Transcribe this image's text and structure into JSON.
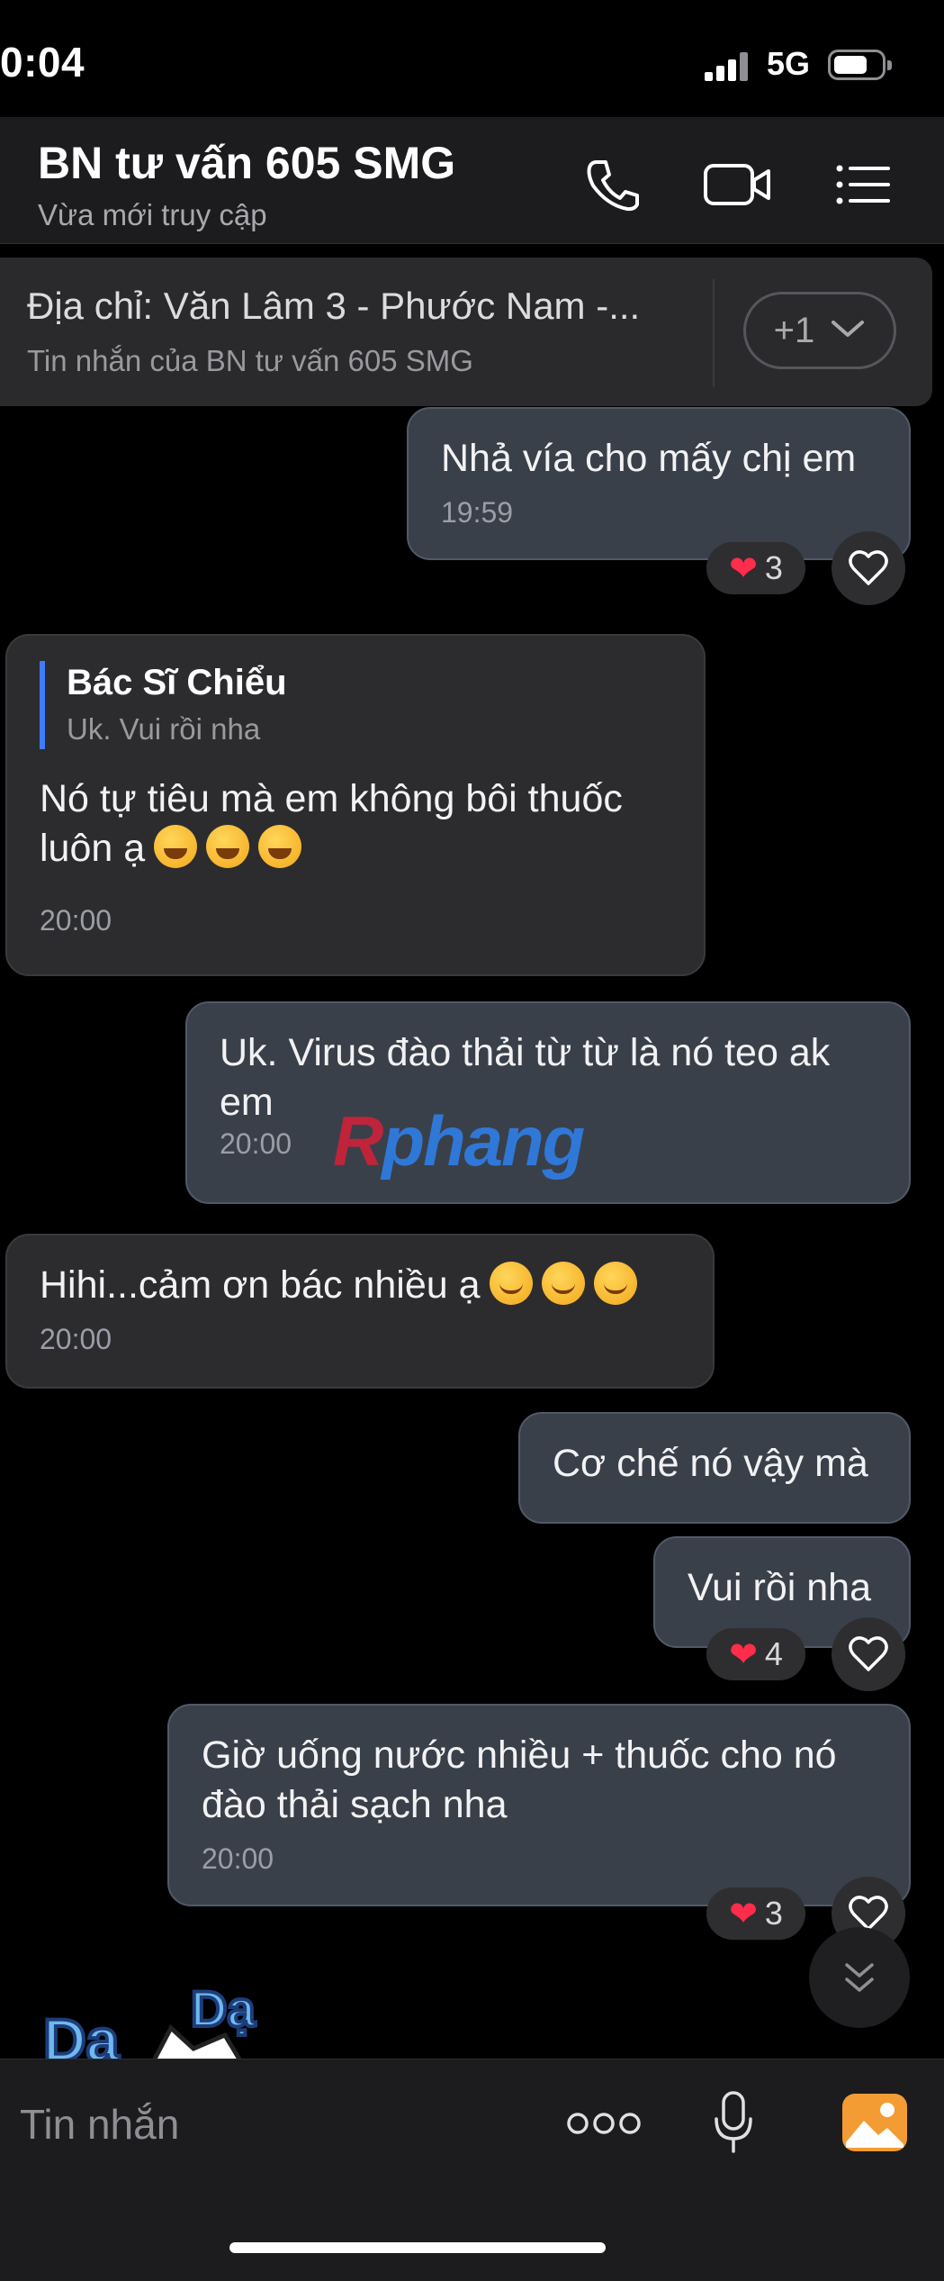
{
  "status": {
    "time": "0:04",
    "network": "5G"
  },
  "header": {
    "title": "BN tư vấn 605 SMG",
    "subtitle": "Vừa mới truy cập"
  },
  "pinned": {
    "text": "Địa chỉ: Văn Lâm 3 - Phước Nam -...",
    "sub": "Tin nhắn của BN tư vấn 605 SMG",
    "more": "+1"
  },
  "messages": {
    "m1": {
      "text": "Nhả vía cho mấy chị em",
      "time": "19:59",
      "reactions": "3"
    },
    "m2": {
      "reply_name": "Bác Sĩ Chiểu",
      "reply_text": "Uk. Vui rồi nha",
      "text_line1": "Nó tự tiêu mà em không bôi thuốc",
      "text_line2": "luôn ạ",
      "time": "20:00"
    },
    "m3": {
      "text_line1": "Uk. Virus đào thải từ từ là nó teo ak",
      "text_line2": "em",
      "time": "20:00"
    },
    "m4": {
      "text": "Hihi...cảm ơn bác nhiều ạ",
      "time": "20:00"
    },
    "m5": {
      "text": "Cơ chế nó vậy mà"
    },
    "m6": {
      "text": "Vui rồi nha",
      "reactions": "4"
    },
    "m7": {
      "text_line1": "Giờ uống nước nhiều + thuốc cho nó",
      "text_line2": "đào thải sạch nha",
      "time": "20:00",
      "reactions": "3"
    }
  },
  "watermark": {
    "r": "R",
    "rest": "phang"
  },
  "sticker": {
    "text1": "Dạ",
    "text2": "Dạ"
  },
  "composer": {
    "placeholder": "Tin nhắn"
  },
  "icons": {
    "call": "phone-icon",
    "video": "video-camera-icon",
    "menu": "list-icon",
    "chevron": "chevron-down-icon",
    "heart": "heart-icon",
    "more": "more-dots-icon",
    "mic": "microphone-icon",
    "image": "image-icon",
    "scroll": "double-chevron-down-icon"
  },
  "colors": {
    "accent_reply_bar": "#3d7bff",
    "my_bubble": "#3a404a",
    "other_bubble": "#2c2c2e",
    "heart": "#ff2d4b",
    "image_icon": "#f39c33"
  }
}
